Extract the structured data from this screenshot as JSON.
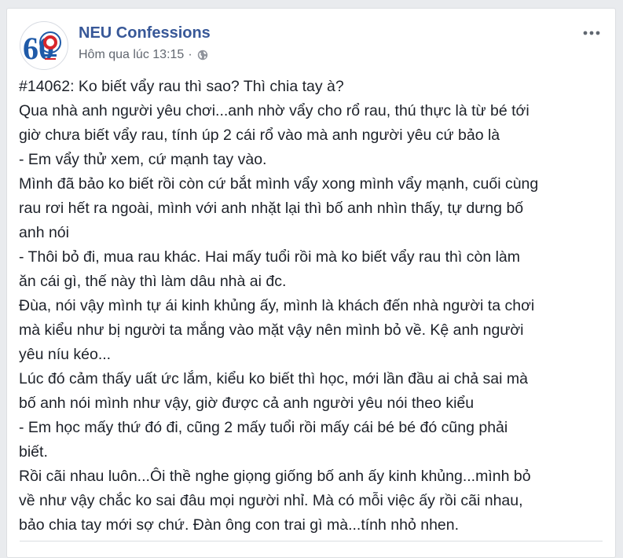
{
  "post": {
    "page_name": "NEU Confessions",
    "timestamp": "Hôm qua lúc 13:15",
    "separator": "·",
    "privacy_icon": "globe-icon",
    "more_icon": "more-options-icon",
    "avatar": {
      "icon": "neu-60-logo",
      "text": "60"
    },
    "lines": [
      "#14062: Ko biết vẩy rau thì sao? Thì chia tay à?",
      "Qua nhà anh người yêu chơi...anh nhờ vẩy cho rổ rau, thú thực là từ bé tới",
      "giờ chưa biết vẩy rau, tính úp 2 cái rổ vào mà anh người yêu cứ bảo là",
      "- Em vẩy thử xem, cứ mạnh tay vào.",
      "Mình đã bảo ko biết rồi còn cứ bắt mình vẩy xong mình vẩy mạnh, cuối cùng",
      "rau rơi hết ra ngoài, mình với anh nhặt lại thì bố anh nhìn thấy, tự dưng bố",
      "anh nói",
      "- Thôi bỏ đi, mua rau khác. Hai mấy tuổi rồi mà ko biết vẩy rau thì còn làm",
      "ăn cái gì, thế này thì làm dâu nhà ai đc.",
      "Đùa, nói vậy mình tự ái kinh khủng ấy, mình là khách đến nhà người ta chơi",
      "mà kiểu như bị người ta mắng vào mặt vậy nên mình bỏ về. Kệ anh người",
      "yêu níu kéo...",
      "Lúc đó cảm thấy uất ức lắm, kiểu ko biết thì học, mới lần đầu ai chả sai mà",
      "bố anh nói mình như vậy, giờ được cả anh người yêu nói theo kiểu",
      "- Em học mấy thứ đó đi, cũng 2 mấy tuổi rồi mấy cái bé bé đó cũng phải",
      "biết.",
      "Rồi cãi nhau luôn...Ôi thề nghe giọng giống bố anh ấy kinh khủng...mình bỏ",
      "về như vậy chắc ko sai đâu mọi người nhỉ. Mà có mỗi việc ấy rồi cãi nhau,",
      "bảo chia tay mới sợ chứ. Đàn ông con trai gì mà...tính nhỏ nhen."
    ]
  },
  "colors": {
    "page_bg": "#e9ebee",
    "card_bg": "#ffffff",
    "name_link": "#385898",
    "meta_text": "#616770",
    "body_text": "#1d2129",
    "logo_blue": "#1f5aa8",
    "logo_red": "#d8252b"
  }
}
